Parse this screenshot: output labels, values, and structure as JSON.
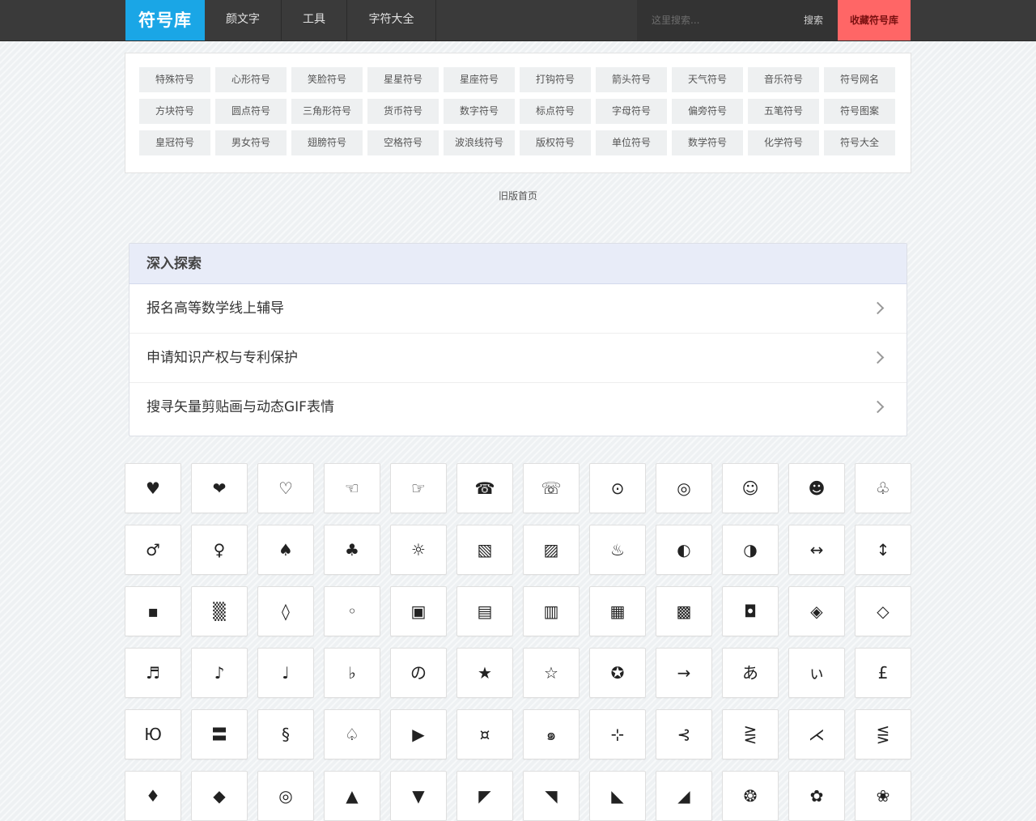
{
  "nav": {
    "logo": "符号库",
    "links": [
      "颜文字",
      "工具",
      "字符大全"
    ],
    "search_placeholder": "这里搜索...",
    "search_label": "搜索",
    "favorite_label": "收藏符号库"
  },
  "categories": [
    "特殊符号",
    "心形符号",
    "笑脸符号",
    "星星符号",
    "星座符号",
    "打钩符号",
    "箭头符号",
    "天气符号",
    "音乐符号",
    "符号网名",
    "方块符号",
    "圆点符号",
    "三角形符号",
    "货币符号",
    "数字符号",
    "标点符号",
    "字母符号",
    "偏旁符号",
    "五笔符号",
    "符号图案",
    "皇冠符号",
    "男女符号",
    "翅膀符号",
    "空格符号",
    "波浪线符号",
    "版权符号",
    "单位符号",
    "数学符号",
    "化学符号",
    "符号大全"
  ],
  "old_home_label": "旧版首页",
  "explore": {
    "title": "深入探索",
    "items": [
      "报名高等数学线上辅导",
      "申请知识产权与专利保护",
      "搜寻矢量剪贴画与动态GIF表情"
    ]
  },
  "symbols": [
    [
      "♥",
      "❤",
      "♡",
      "☜",
      "☞",
      "☎",
      "☏",
      "⊙",
      "◎",
      "☺",
      "☻",
      "♧"
    ],
    [
      "♂",
      "♀",
      "♠",
      "♣",
      "☼",
      "▧",
      "▨",
      "♨",
      "◐",
      "◑",
      "↔",
      "↕"
    ],
    [
      "▪",
      "▒",
      "◊",
      "◦",
      "▣",
      "▤",
      "▥",
      "▦",
      "▩",
      "◘",
      "◈",
      "◇"
    ],
    [
      "♬",
      "♪",
      "♩",
      "♭",
      "の",
      "★",
      "☆",
      "✪",
      "→",
      "あ",
      "ぃ",
      "£"
    ],
    [
      "Ю",
      "〓",
      "§",
      "♤",
      "▶",
      "¤",
      "๑",
      "⊹",
      "⊰",
      "⋛",
      "⋌",
      "⋚"
    ],
    [
      "♦",
      "◆",
      "◎",
      "▲",
      "▼",
      "◤",
      "◥",
      "◣",
      "◢",
      "❂",
      "✿",
      "❀"
    ]
  ]
}
